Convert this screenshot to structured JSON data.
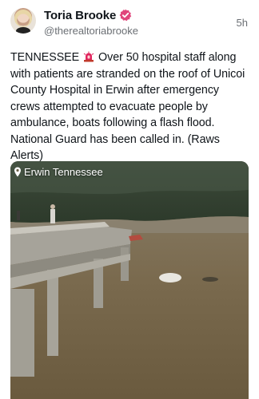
{
  "post": {
    "author_name": "Toria Brooke",
    "author_handle": "@therealtoriabrooke",
    "timestamp": "5h",
    "text_prefix": "TENNESSEE",
    "text_body": "Over 50 hospital staff along with patients are stranded on the roof of Unicoi County Hospital in Erwin after emergency crews attempted to evacuate people by ambulance, boats following a flash flood. National Guard has been called in. (Raws Alerts)",
    "icons": {
      "verified": "verified-badge-icon",
      "emoji": "police-light-icon",
      "location": "location-pin-icon"
    },
    "colors": {
      "verified": "#e0457b",
      "siren": "#e0245e",
      "muted_text": "#6b6f74"
    }
  },
  "media": {
    "location_label": "Erwin Tennessee"
  }
}
